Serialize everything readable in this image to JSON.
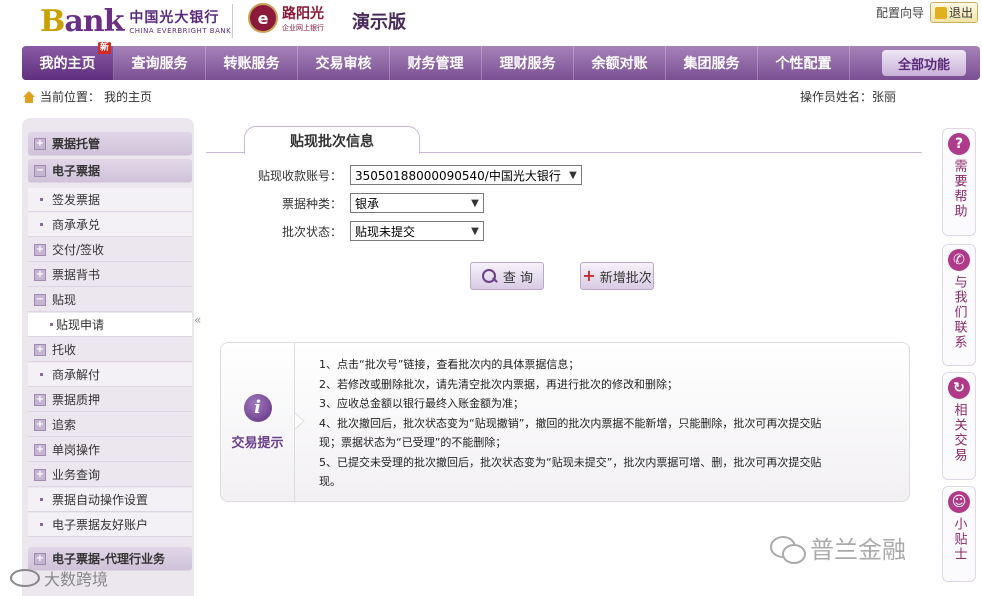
{
  "header": {
    "bank_logo_letter": "B",
    "bank_logo_rest": "ank",
    "bank_name_cn": "中国光大银行",
    "bank_name_en": "CHINA EVERBRIGHT BANK",
    "partner_seal": "e",
    "partner_name": "路阳光",
    "partner_sub": "企业网上银行",
    "demo_label": "演示版",
    "config_link": "配置向导",
    "exit_label": "退出"
  },
  "nav": {
    "items": [
      {
        "label": "我的主页"
      },
      {
        "label": "查询服务"
      },
      {
        "label": "转账服务"
      },
      {
        "label": "交易审核"
      },
      {
        "label": "财务管理"
      },
      {
        "label": "理财服务"
      },
      {
        "label": "余额对账"
      },
      {
        "label": "集团服务"
      },
      {
        "label": "个性配置"
      }
    ],
    "badge": "新",
    "all_functions": "全部功能"
  },
  "breadcrumb": {
    "prefix": "当前位置：",
    "current": "我的主页"
  },
  "operator": "操作员姓名：张丽",
  "sidebar": {
    "items": [
      {
        "label": "票据托管",
        "kind": "head",
        "marker": "+"
      },
      {
        "label": "电子票据",
        "kind": "head",
        "marker": "−"
      },
      {
        "label": "签发票据",
        "kind": "sub"
      },
      {
        "label": "商承承兑",
        "kind": "sub"
      },
      {
        "label": "交付/签收",
        "kind": "group",
        "marker": "+"
      },
      {
        "label": "票据背书",
        "kind": "group",
        "marker": "+"
      },
      {
        "label": "贴现",
        "kind": "group",
        "marker": "−"
      },
      {
        "label": "贴现申请",
        "kind": "active"
      },
      {
        "label": "托收",
        "kind": "group",
        "marker": "+"
      },
      {
        "label": "商承解付",
        "kind": "sub"
      },
      {
        "label": "票据质押",
        "kind": "group",
        "marker": "+"
      },
      {
        "label": "追索",
        "kind": "group",
        "marker": "+"
      },
      {
        "label": "单岗操作",
        "kind": "group",
        "marker": "+"
      },
      {
        "label": "业务查询",
        "kind": "group",
        "marker": "+"
      },
      {
        "label": "票据自动操作设置",
        "kind": "sub"
      },
      {
        "label": "电子票据友好账户",
        "kind": "sub"
      },
      {
        "label": "电子票据-代理行业务",
        "kind": "head",
        "marker": "+"
      }
    ]
  },
  "main": {
    "tab_title": "贴现批次信息",
    "form": {
      "account_label": "贴现收款账号：",
      "account_value": "35050188000090540/中国光大银行",
      "type_label": "票据种类：",
      "type_value": "银承",
      "status_label": "批次状态：",
      "status_value": "贴现未提交"
    },
    "query_button": "查 询",
    "add_button": "新增批次"
  },
  "tips": {
    "title": "交易提示",
    "icon_char": "i",
    "lines": [
      "1、点击“批次号”链接，查看批次内的具体票据信息；",
      "2、若修改或删除批次，请先清空批次内票据，再进行批次的修改和删除；",
      "3、应收总金额以银行最终入账金额为准；",
      "4、批次撤回后，批次状态变为“贴现撤销”，撤回的批次内票据不能新增，只能删除，批次可再次提交贴",
      "现；票据状态为“已受理”的不能删除；",
      "5、已提交未受理的批次撤回后，批次状态变为“贴现未提交”，批次内票据可增、删，批次可再次提交贴",
      "现。"
    ]
  },
  "rail": [
    {
      "label": "需要帮助",
      "icon": "?",
      "icon_name": "help-icon"
    },
    {
      "label": "与我们联系",
      "icon": "✆",
      "icon_name": "phone-icon"
    },
    {
      "label": "相关交易",
      "icon": "↻",
      "icon_name": "refresh-icon"
    },
    {
      "label": "小贴士",
      "icon": "☺",
      "icon_name": "smile-icon"
    }
  ],
  "collapse_glyph": "«",
  "watermarks": {
    "right": "普兰金融",
    "left": "大数跨境"
  },
  "colors": {
    "brand_purple": "#6b2f86",
    "nav_purple": "#7a4f93",
    "brand_gold": "#c8a000",
    "accent_red": "#d6281f"
  }
}
